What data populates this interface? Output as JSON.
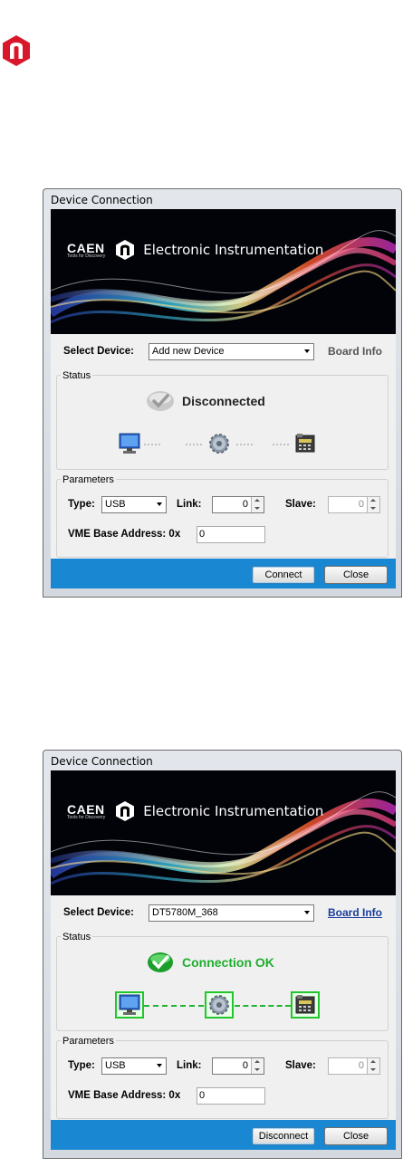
{
  "colors": {
    "brand_red": "#d8182a",
    "footer_blue": "#1a87d2",
    "connected_green": "#1fae2e",
    "link_blue": "#1a3d9c"
  },
  "logo": {
    "icon": "caen-n-hexagon-icon"
  },
  "windows": [
    {
      "title": "Device Connection",
      "banner": {
        "brand": "CAEN",
        "brand_tagline": "Tools for Discovery",
        "tagline": "Electronic Instrumentation"
      },
      "select_device": {
        "label": "Select Device:",
        "value": "Add new Device",
        "board_info": "Board Info",
        "board_info_enabled": false
      },
      "status": {
        "group_title": "Status",
        "text": "Disconnected",
        "state": "disconnected",
        "icons": [
          "monitor-icon",
          "gear-icon",
          "board-device-icon"
        ]
      },
      "parameters": {
        "group_title": "Parameters",
        "type_label": "Type:",
        "type_value": "USB",
        "link_label": "Link:",
        "link_value": "0",
        "slave_label": "Slave:",
        "slave_value": "0",
        "vme_label": "VME Base Address: 0x",
        "vme_value": "0"
      },
      "buttons": {
        "primary": "Connect",
        "secondary": "Close"
      }
    },
    {
      "title": "Device Connection",
      "banner": {
        "brand": "CAEN",
        "brand_tagline": "Tools for Discovery",
        "tagline": "Electronic Instrumentation"
      },
      "select_device": {
        "label": "Select Device:",
        "value": "DT5780M_368",
        "board_info": "Board Info",
        "board_info_enabled": true
      },
      "status": {
        "group_title": "Status",
        "text": "Connection OK",
        "state": "connected",
        "icons": [
          "monitor-icon",
          "gear-icon",
          "board-device-icon"
        ]
      },
      "parameters": {
        "group_title": "Parameters",
        "type_label": "Type:",
        "type_value": "USB",
        "link_label": "Link:",
        "link_value": "0",
        "slave_label": "Slave:",
        "slave_value": "0",
        "vme_label": "VME Base Address: 0x",
        "vme_value": "0"
      },
      "buttons": {
        "primary": "Disconnect",
        "secondary": "Close"
      }
    }
  ]
}
